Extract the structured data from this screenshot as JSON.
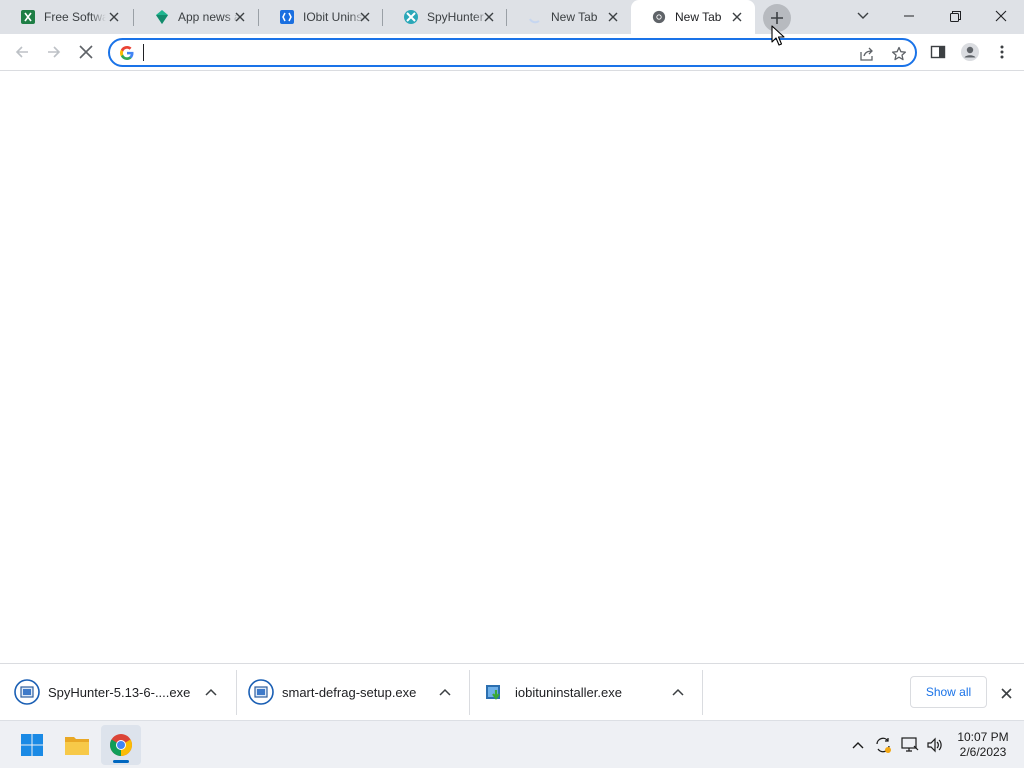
{
  "browser": {
    "tabs": [
      {
        "title": "Free Software",
        "icon": "spreadsheet-favicon-icon",
        "active": false
      },
      {
        "title": "App news and",
        "icon": "diamond-favicon-icon",
        "active": false
      },
      {
        "title": "IObit Uninstaller",
        "icon": "iobit-favicon-icon",
        "active": false
      },
      {
        "title": "SpyHunter",
        "icon": "spyhunter-favicon-icon",
        "active": false
      },
      {
        "title": "New Tab",
        "icon": "loading-spinner-icon",
        "active": false
      },
      {
        "title": "New Tab",
        "icon": "chrome-favicon-icon",
        "active": true
      }
    ],
    "new_tab_icon": "plus-icon",
    "window_controls": [
      "tab-search-icon",
      "minimize-icon",
      "restore-icon",
      "close-icon"
    ]
  },
  "toolbar": {
    "back_icon": "back-arrow-icon",
    "forward_icon": "forward-arrow-icon",
    "stop_icon": "stop-loading-icon",
    "omnibox": {
      "value": "",
      "placeholder": ""
    },
    "share_icon": "share-icon",
    "bookmark_icon": "star-icon",
    "side_panel_icon": "side-panel-icon",
    "profile_icon": "profile-icon",
    "menu_icon": "kebab-menu-icon"
  },
  "downloads": {
    "items": [
      {
        "name": "SpyHunter-5.13-6-....exe",
        "icon": "installer-file-icon"
      },
      {
        "name": "smart-defrag-setup.exe",
        "icon": "installer-file-icon"
      },
      {
        "name": "iobituninstaller.exe",
        "icon": "iobit-installer-icon"
      }
    ],
    "show_all_label": "Show all"
  },
  "taskbar": {
    "apps": [
      "windows-start-icon",
      "file-explorer-icon",
      "chrome-icon"
    ],
    "tray": [
      "show-hidden-icons-chevron",
      "sync-update-icon",
      "network-icon",
      "volume-icon"
    ],
    "time": "10:07 PM",
    "date": "2/6/2023"
  },
  "colors": {
    "tabstrip": "#dee1e6",
    "accent": "#1a73e8",
    "taskbar": "#eef0f4"
  }
}
